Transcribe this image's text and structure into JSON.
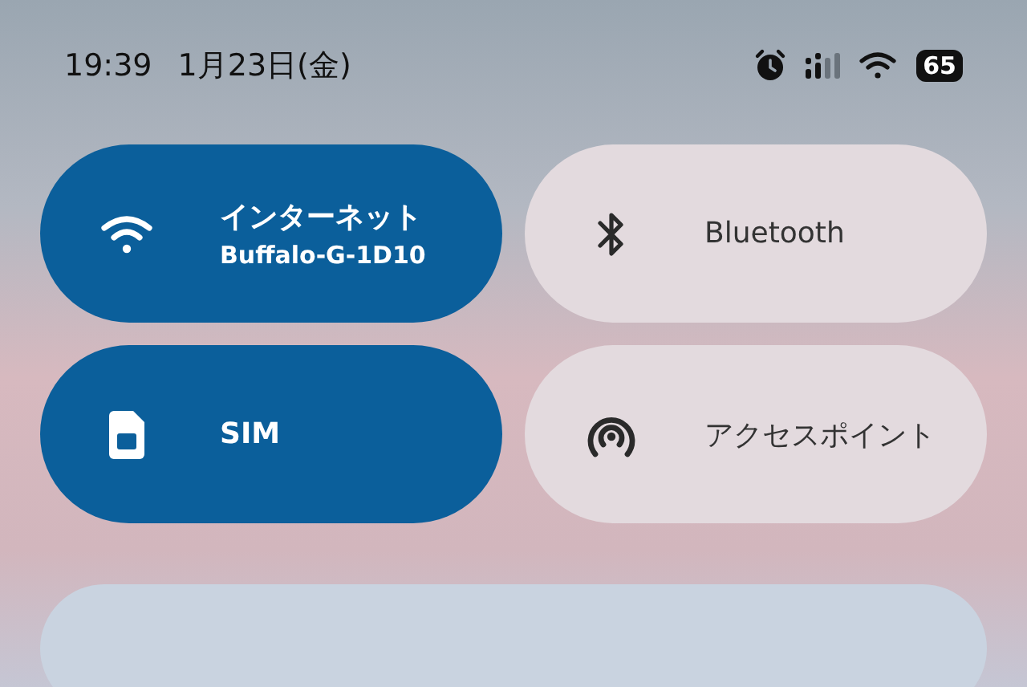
{
  "status_bar": {
    "time": "19:39",
    "date": "1月23日(金)",
    "battery": "65"
  },
  "tiles": [
    {
      "kind": "wifi",
      "label": "インターネット",
      "sublabel": "Buffalo-G-1D10",
      "on": true
    },
    {
      "kind": "bluetooth",
      "label": "Bluetooth",
      "on": false
    },
    {
      "kind": "sim",
      "label": "SIM",
      "on": true
    },
    {
      "kind": "hotspot",
      "label": "アクセスポイント",
      "on": false
    }
  ]
}
